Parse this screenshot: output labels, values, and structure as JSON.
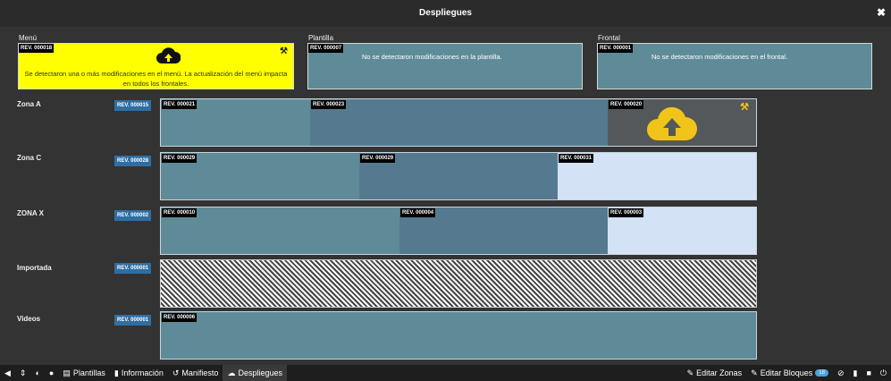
{
  "window": {
    "title": "Despliegues"
  },
  "sections": {
    "menu": {
      "label": "Menú",
      "rev": "REV. 000018",
      "message": "Se detectaron una o más modificaciones en el menú. La actualización del menú impacta en todos los frontales.",
      "icon": "cloud-upload-icon"
    },
    "plantilla": {
      "label": "Plantilla",
      "rev": "REV. 000007",
      "message": "No se detectaron modificaciones en la plantilla."
    },
    "frontal": {
      "label": "Frontal",
      "rev": "REV. 000001",
      "message": "No se detectaron modificaciones en el frontal."
    }
  },
  "zones": [
    {
      "name": "Zona A",
      "rev": "REV. 000015",
      "segments": [
        "REV. 000021",
        "REV. 000023",
        "REV. 000020"
      ]
    },
    {
      "name": "Zona C",
      "rev": "REV. 000028",
      "segments": [
        "REV. 000029",
        "REV. 000029",
        "REV. 000031"
      ]
    },
    {
      "name": "ZONA X",
      "rev": "REV. 000002",
      "segments": [
        "REV. 000010",
        "REV. 000004",
        "REV. 000003"
      ]
    },
    {
      "name": "Importada",
      "rev": "REV. 000001",
      "segments": []
    },
    {
      "name": "Videos",
      "rev": "REV. 000001",
      "segments": [
        "REV. 000006"
      ]
    }
  ],
  "bottom": {
    "plantillas": "Plantillas",
    "informacion": "Información",
    "manifiesto": "Manifiesto",
    "despliegues": "Despliegues",
    "editar_zonas": "Editar Zonas",
    "editar_bloques": "Editar Bloques",
    "bloques_count": "18"
  },
  "colors": {
    "menu_alert": "#ffff00",
    "card": "#5f8b98",
    "cloud": "#f0c419",
    "rev_badge": "#2f6ea3"
  }
}
